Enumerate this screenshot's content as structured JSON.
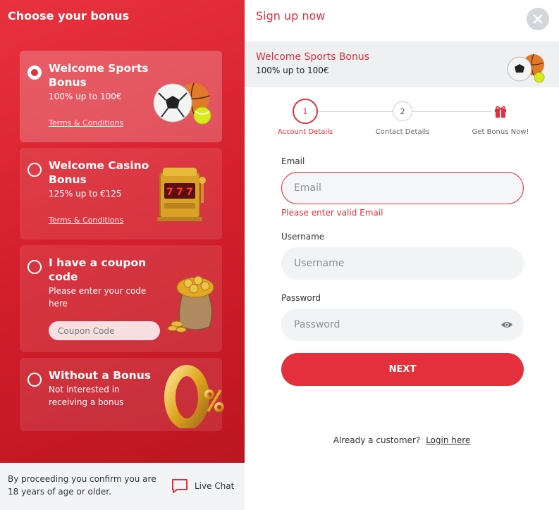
{
  "left": {
    "title": "Choose your bonus",
    "cards": [
      {
        "title": "Welcome Sports Bonus",
        "subtitle": "100% up to 100€",
        "terms": "Terms & Conditions",
        "selected": true
      },
      {
        "title": "Welcome Casino Bonus",
        "subtitle": "125% up to €125",
        "terms": "Terms & Conditions",
        "selected": false
      },
      {
        "title": "I have a coupon code",
        "subtitle": "Please enter your code here",
        "coupon_placeholder": "Coupon Code",
        "selected": false
      },
      {
        "title": "Without a Bonus",
        "subtitle": "Not interested in receiving a bonus",
        "selected": false
      }
    ],
    "footer": {
      "age_notice": "By proceeding you confirm you are 18 years of age or older.",
      "live_chat": "Live Chat"
    }
  },
  "right": {
    "title": "Sign up now",
    "banner": {
      "title": "Welcome Sports Bonus",
      "subtitle": "100% up to 100€"
    },
    "steps": [
      {
        "number": "1",
        "label": "Account Details",
        "active": true
      },
      {
        "number": "2",
        "label": "Contact Details",
        "active": false
      },
      {
        "label": "Get Bonus Now!",
        "icon": "gift-icon",
        "active": false
      }
    ],
    "form": {
      "email_label": "Email",
      "email_placeholder": "Email",
      "email_error": "Please enter valid Email",
      "username_label": "Username",
      "username_placeholder": "Username",
      "password_label": "Password",
      "password_placeholder": "Password",
      "next_label": "NEXT"
    },
    "login": {
      "prompt": "Already a customer?",
      "link": "Login here"
    }
  },
  "colors": {
    "accent": "#e3303c",
    "panel_red": "#d41f2c",
    "field_bg": "#f1f3f5"
  }
}
